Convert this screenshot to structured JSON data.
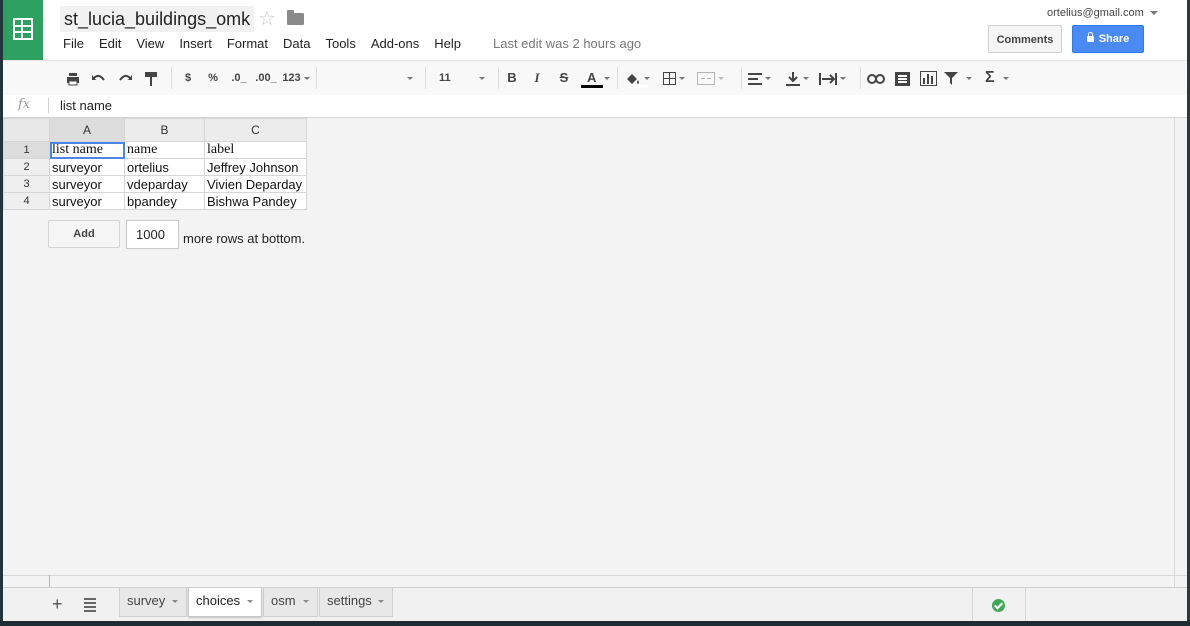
{
  "document": {
    "title": "st_lucia_buildings_omk",
    "last_edit": "Last edit was 2 hours ago",
    "account": "ortelius@gmail.com"
  },
  "menu": [
    "File",
    "Edit",
    "View",
    "Insert",
    "Format",
    "Data",
    "Tools",
    "Add-ons",
    "Help"
  ],
  "header_buttons": {
    "comments": "Comments",
    "share": "Share"
  },
  "toolbar": {
    "currency": "$",
    "percent": "%",
    "decrease_decimals": ".0_",
    "increase_decimals": ".00_",
    "number_format": "123",
    "font_family": "",
    "font_size": "11",
    "bold": "B",
    "italic": "I",
    "strikethrough": "S",
    "text_color": "A"
  },
  "formula_bar": {
    "fx_label": "fx",
    "value": "list name"
  },
  "grid": {
    "column_headers": [
      "A",
      "B",
      "C"
    ],
    "rows": [
      {
        "num": "1",
        "cells": [
          "list name",
          "name",
          "label"
        ]
      },
      {
        "num": "2",
        "cells": [
          "surveyor",
          "ortelius",
          "Jeffrey Johnson"
        ]
      },
      {
        "num": "3",
        "cells": [
          "surveyor",
          "vdeparday",
          "Vivien Deparday"
        ]
      },
      {
        "num": "4",
        "cells": [
          "surveyor",
          "bpandey",
          "Bishwa Pandey"
        ]
      }
    ]
  },
  "add_rows": {
    "button": "Add",
    "count": "1000",
    "suffix": "more rows at bottom."
  },
  "sheet_tabs": [
    {
      "label": "survey",
      "active": false
    },
    {
      "label": "choices",
      "active": true
    },
    {
      "label": "osm",
      "active": false
    },
    {
      "label": "settings",
      "active": false
    }
  ],
  "status": {
    "saved_icon": "check-circle-icon",
    "color": "#3eaa55"
  },
  "colors": {
    "brand_green": "#2da160",
    "share_blue": "#4a8af4",
    "selection_blue": "#4a86e8"
  }
}
